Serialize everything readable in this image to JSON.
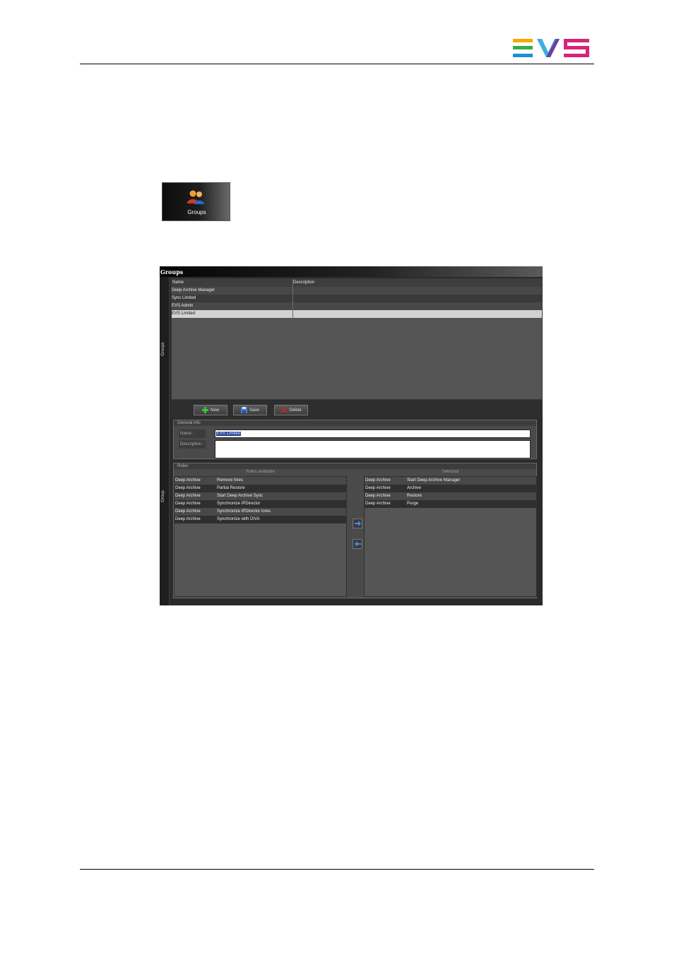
{
  "groups_tile": {
    "icon": "users-icon",
    "label": "Groups"
  },
  "window": {
    "title": "Groups",
    "side_tabs": [
      "Groups",
      "Group"
    ]
  },
  "groups_grid": {
    "columns": [
      "Name",
      "Description"
    ],
    "rows": [
      {
        "name": "Deep Archive Manager",
        "description": ""
      },
      {
        "name": "Sync Limited",
        "description": ""
      },
      {
        "name": "EVS Admin",
        "description": ""
      },
      {
        "name": "EVS Limited",
        "description": ""
      }
    ],
    "selected_row": "EVS Limited"
  },
  "toolbar": {
    "new_label": "New",
    "save_label": "Save",
    "delete_label": "Delete"
  },
  "general_info": {
    "title": "General info",
    "name_label": "Name :",
    "name_value": "EVS Limited",
    "description_label": "Description :",
    "description_value": ""
  },
  "roles": {
    "title": "Roles",
    "available_header": "Roles available",
    "selected_header": "Selected",
    "available": [
      {
        "category": "Deep Archive",
        "role": "Remove hires"
      },
      {
        "category": "Deep Archive",
        "role": "Partial Restore"
      },
      {
        "category": "Deep Archive",
        "role": "Start Deep Archive Sync"
      },
      {
        "category": "Deep Archive",
        "role": "Synchronize IPDirector"
      },
      {
        "category": "Deep Archive",
        "role": "Synchronize IPDirector lores"
      },
      {
        "category": "Deep Archive",
        "role": "Synchronize with DIVA"
      }
    ],
    "selected": [
      {
        "category": "Deep Archive",
        "role": "Start Deep Archive Manager"
      },
      {
        "category": "Deep Archive",
        "role": "Archive"
      },
      {
        "category": "Deep Archive",
        "role": "Restore"
      },
      {
        "category": "Deep Archive",
        "role": "Purge"
      }
    ],
    "add_icon": "arrow-right-icon",
    "remove_icon": "arrow-left-icon"
  },
  "colors": {
    "selection_highlight": "#1b3f90",
    "arrow_blue": "#3d8ef0",
    "new_green": "#3cc43c",
    "delete_red": "#e02020"
  }
}
